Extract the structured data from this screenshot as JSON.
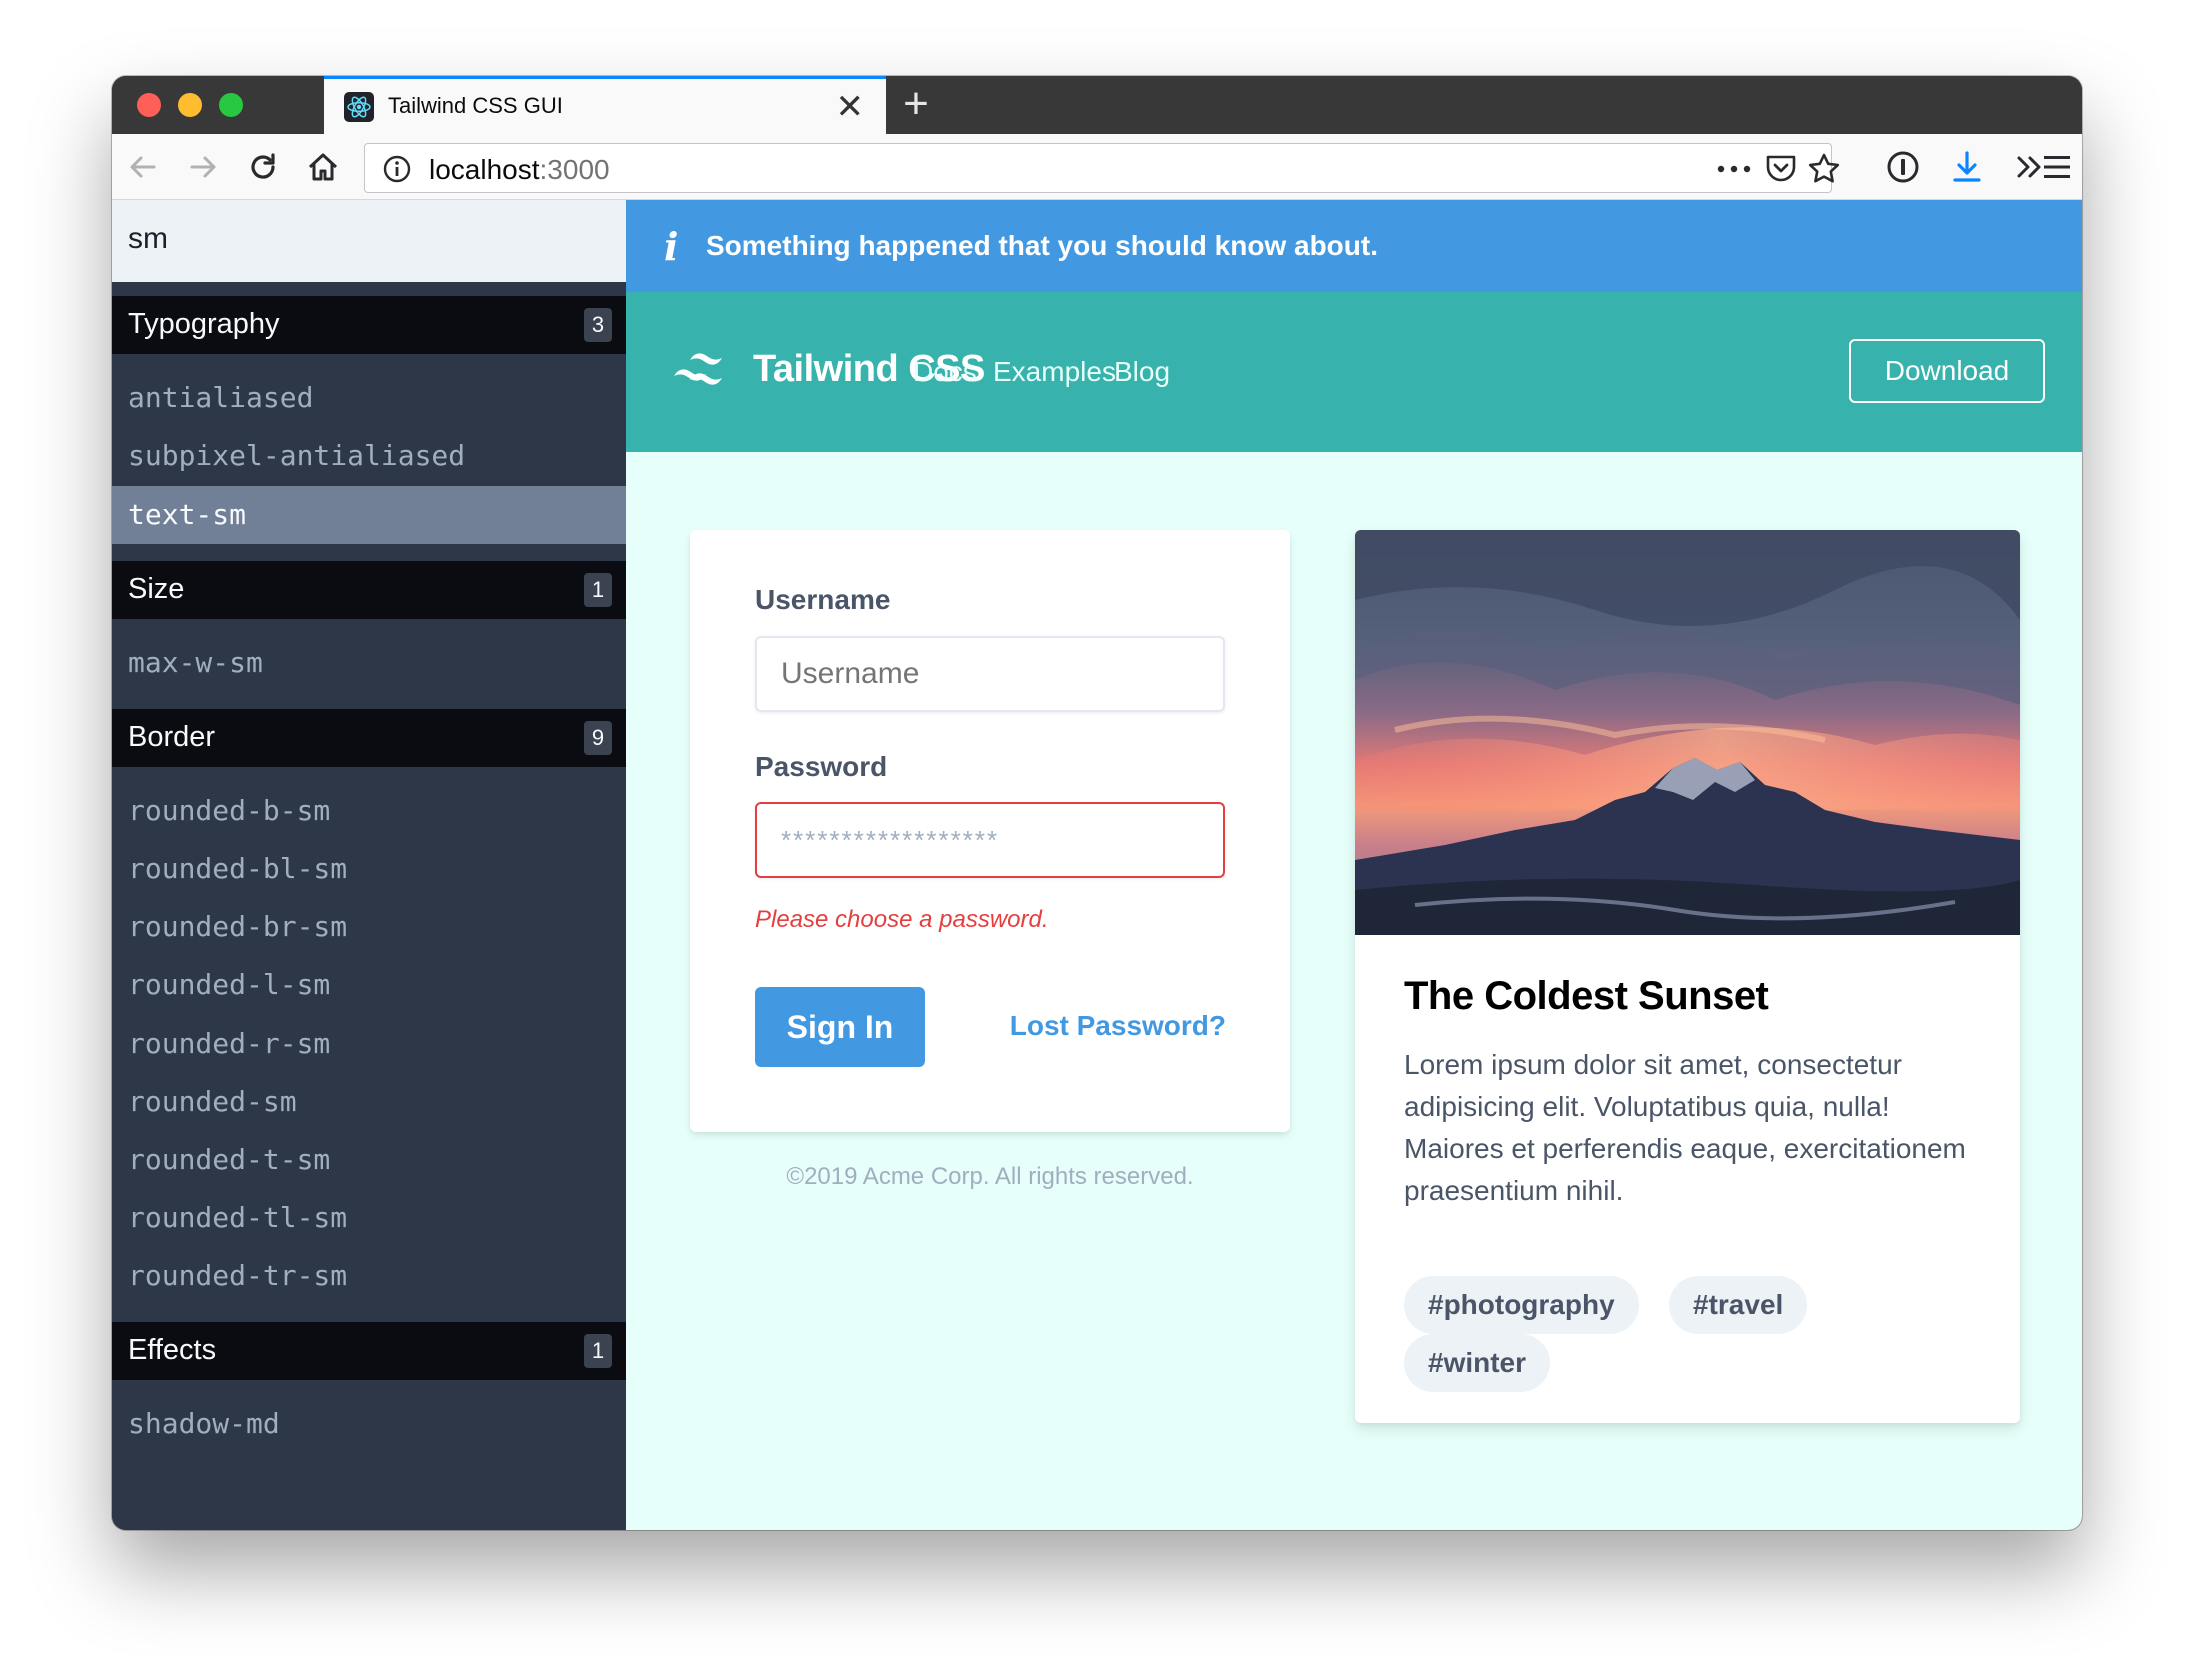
{
  "browser": {
    "tab_title": "Tailwind CSS GUI",
    "tab_close": "✕",
    "new_tab": "+",
    "url_host": "localhost",
    "url_port": ":3000"
  },
  "sidebar": {
    "search_value": "sm",
    "groups": [
      {
        "title": "Typography",
        "count": "3",
        "items": [
          "antialiased",
          "subpixel-antialiased",
          "text-sm"
        ]
      },
      {
        "title": "Size",
        "count": "1",
        "items": [
          "max-w-sm"
        ]
      },
      {
        "title": "Border",
        "count": "9",
        "items": [
          "rounded-b-sm",
          "rounded-bl-sm",
          "rounded-br-sm",
          "rounded-l-sm",
          "rounded-r-sm",
          "rounded-sm",
          "rounded-t-sm",
          "rounded-tl-sm",
          "rounded-tr-sm"
        ]
      },
      {
        "title": "Effects",
        "count": "1",
        "items": [
          "shadow-md"
        ]
      }
    ],
    "active_item": "text-sm"
  },
  "alert": {
    "icon": "info-icon",
    "text": "Something happened that you should know about."
  },
  "header": {
    "brand": "Tailwind CSS",
    "nav": [
      "Docs",
      "Examples",
      "Blog"
    ],
    "download": "Download"
  },
  "login": {
    "username_label": "Username",
    "username_placeholder": "Username",
    "password_label": "Password",
    "password_value": "******************",
    "password_error": "Please choose a password.",
    "signin": "Sign In",
    "lost_password": "Lost Password?",
    "copyright": "©2019 Acme Corp. All rights reserved."
  },
  "card": {
    "title": "The Coldest Sunset",
    "body": "Lorem ipsum dolor sit amet, consectetur adipisicing elit. Voluptatibus quia, nulla! Maiores et perferendis eaque, exercitationem praesentium nihil.",
    "tags": [
      "#photography",
      "#travel",
      "#winter"
    ]
  },
  "colors": {
    "alert_bg": "#4299e1",
    "header_bg": "#38b2ac",
    "main_bg": "#e6fffa",
    "sidebar_bg": "#2d3748",
    "error": "#e53e3e"
  }
}
